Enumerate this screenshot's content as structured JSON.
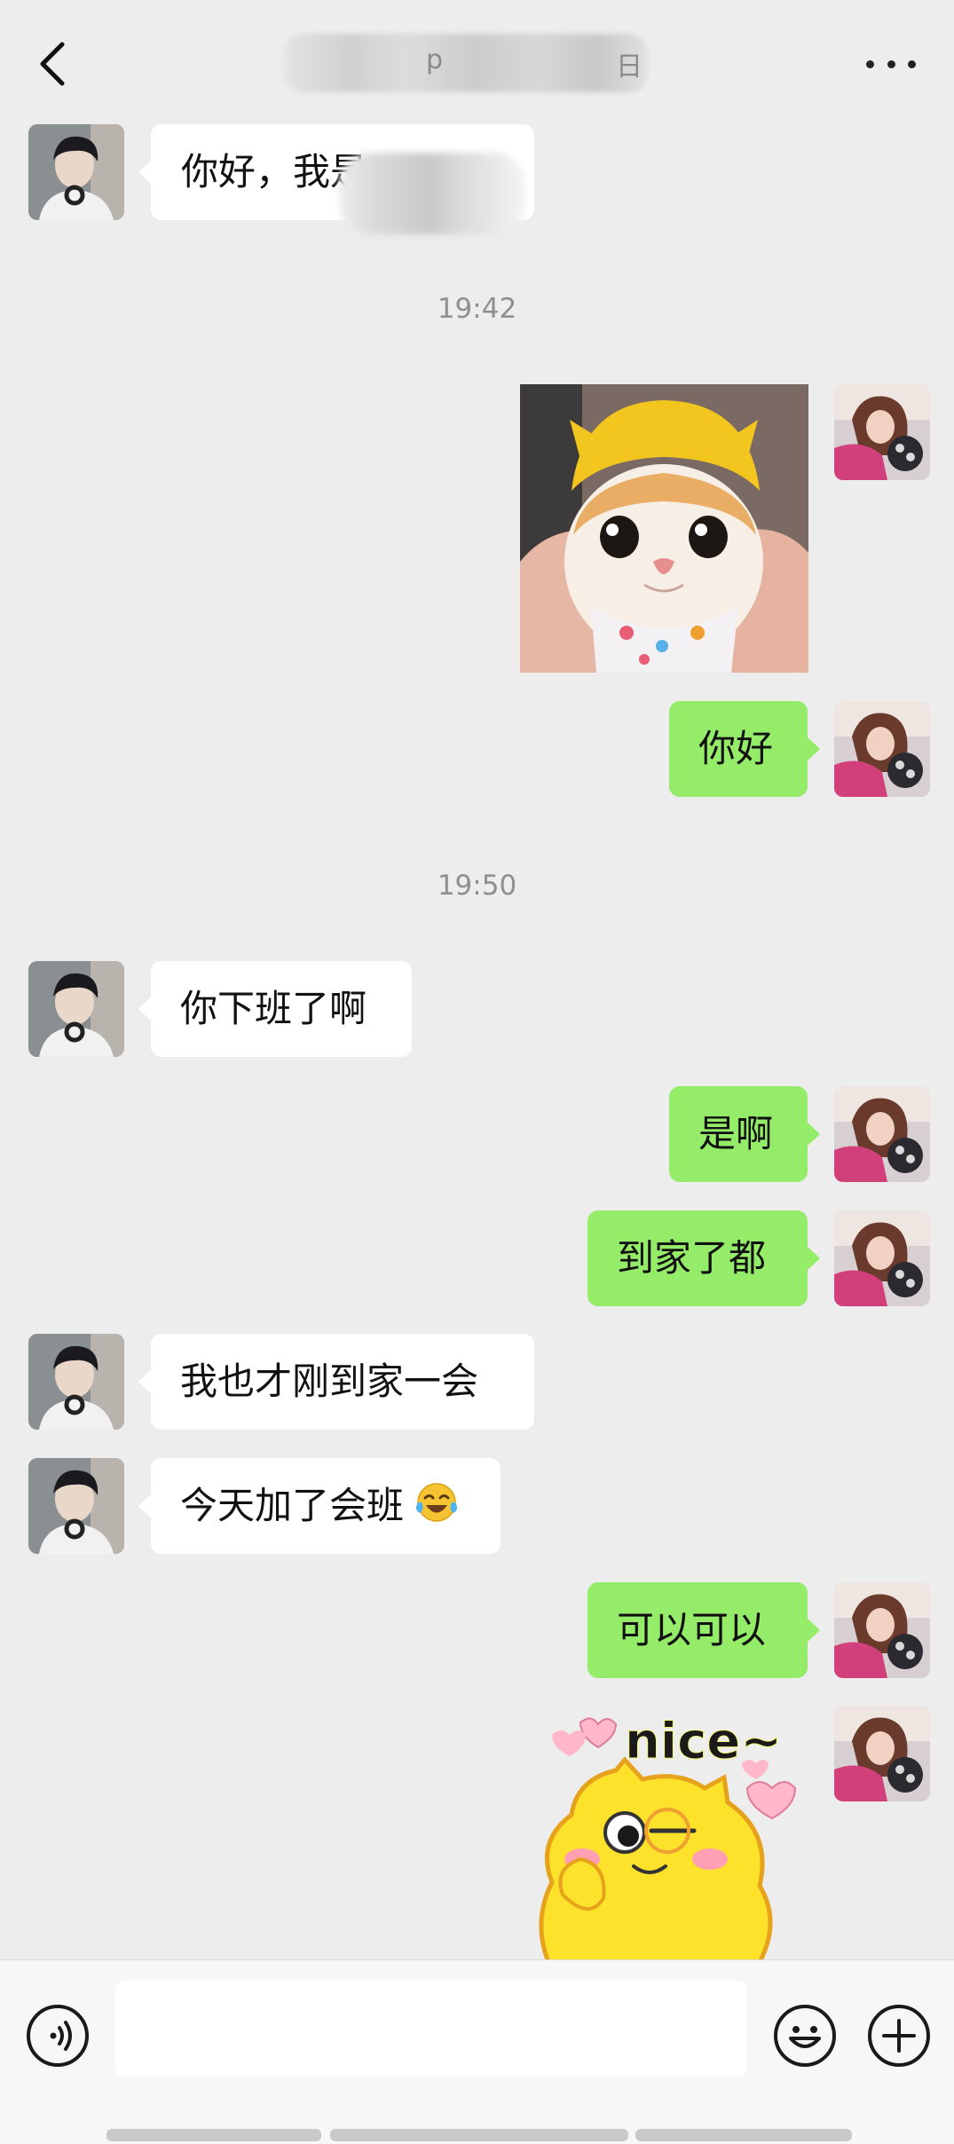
{
  "header": {
    "title_fragment_1": "p",
    "title_fragment_2": "日",
    "back_icon": "back-chevron-icon",
    "more_icon": "more-dots-icon"
  },
  "messages": [
    {
      "side": "left",
      "text": "你好，我是",
      "redacted": true
    },
    {
      "type": "timestamp",
      "text": "19:42"
    },
    {
      "side": "right",
      "type": "image",
      "image": "cat-in-yellow-hat-photo"
    },
    {
      "side": "right",
      "text": "你好"
    },
    {
      "type": "timestamp",
      "text": "19:50"
    },
    {
      "side": "left",
      "text": "你下班了啊"
    },
    {
      "side": "right",
      "text": "是啊"
    },
    {
      "side": "right",
      "text": "到家了都"
    },
    {
      "side": "left",
      "text": "我也才刚到家一会"
    },
    {
      "side": "left",
      "text": "今天加了会班",
      "emoji": "laugh-cry-emoji"
    },
    {
      "side": "right",
      "text": "可以可以"
    },
    {
      "side": "right",
      "type": "sticker",
      "sticker_text": "nice~"
    }
  ],
  "input_bar": {
    "voice_icon": "voice-icon",
    "input_value": "",
    "emoji_icon": "emoji-icon",
    "add_icon": "add-icon"
  },
  "colors": {
    "bg": "#ededed",
    "sent_bubble": "#95ec69",
    "received_bubble": "#ffffff",
    "timestamp": "#8f8f8f"
  }
}
